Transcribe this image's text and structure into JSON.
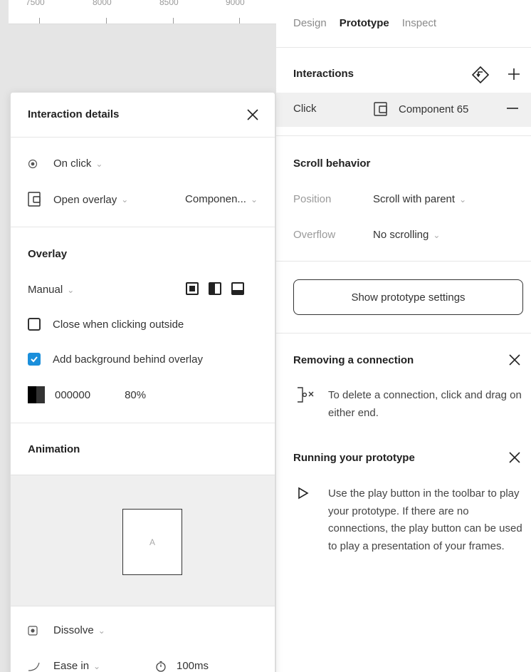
{
  "ruler": {
    "labels": [
      "7500",
      "8000",
      "8500",
      "9000"
    ]
  },
  "right_panel": {
    "tabs": [
      {
        "label": "Design",
        "active": false
      },
      {
        "label": "Prototype",
        "active": true
      },
      {
        "label": "Inspect",
        "active": false
      }
    ],
    "interactions": {
      "title": "Interactions",
      "rows": [
        {
          "trigger": "Click",
          "target": "Component 65"
        }
      ]
    },
    "scroll_behavior": {
      "title": "Scroll behavior",
      "position_label": "Position",
      "position_value": "Scroll with parent",
      "overflow_label": "Overflow",
      "overflow_value": "No scrolling"
    },
    "prototype_settings_button": "Show prototype settings",
    "tips": [
      {
        "title": "Removing a connection",
        "text": "To delete a connection, click and drag on either end."
      },
      {
        "title": "Running your prototype",
        "text": "Use the play button in the toolbar to play your prototype. If there are no connections, the play button can be used to play a presentation of your frames."
      }
    ]
  },
  "details": {
    "title": "Interaction details",
    "trigger": "On click",
    "action": "Open overlay",
    "destination": "Componen...",
    "overlay": {
      "title": "Overlay",
      "position": "Manual",
      "close_outside_label": "Close when clicking outside",
      "close_outside_checked": false,
      "background_label": "Add background behind overlay",
      "background_checked": true,
      "color_hex": "000000",
      "opacity": "80%"
    },
    "animation": {
      "title": "Animation",
      "preview_label": "A",
      "type": "Dissolve",
      "easing": "Ease in",
      "duration": "100ms"
    }
  },
  "colors": {
    "accent": "#1b8fdb",
    "canvas": "#e5e5e5",
    "row_highlight": "#f0f0f0"
  }
}
